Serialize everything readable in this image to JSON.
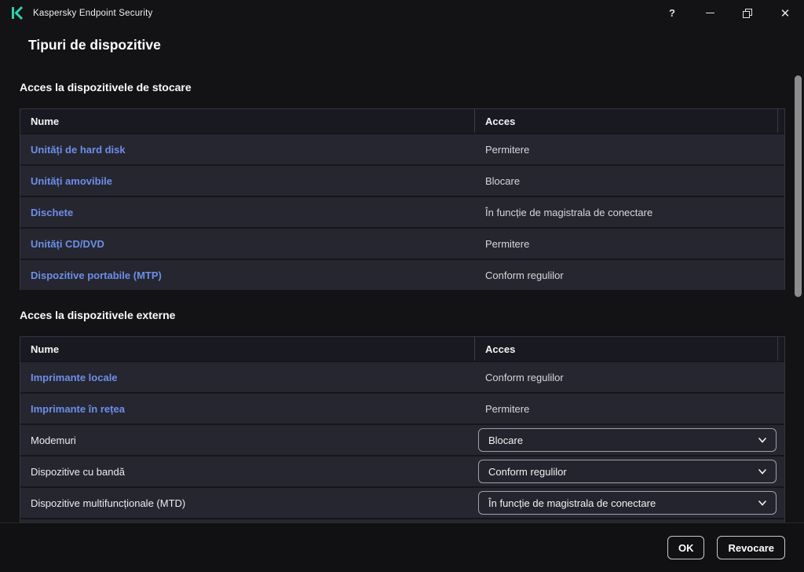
{
  "titlebar": {
    "app_title": "Kaspersky Endpoint Security",
    "help_glyph": "?",
    "close_glyph": "✕"
  },
  "icons": {
    "kaspersky_logo": "teal K mark",
    "minimize": "horizontal bar",
    "restore": "two overlapping squares",
    "close": "x cross",
    "chevron_down": "v chevron"
  },
  "colors": {
    "accent_teal": "#2ed0ae",
    "link_blue": "#6d8ee9",
    "row_bg": "#262630",
    "header_bg": "#191921",
    "page_bg": "#131316"
  },
  "page": {
    "title": "Tipuri de dispozitive"
  },
  "sections": [
    {
      "heading": "Acces la dispozitivele de stocare",
      "columns": {
        "name": "Nume",
        "access": "Acces"
      },
      "rows": [
        {
          "name": "Unități de hard disk",
          "access": "Permitere"
        },
        {
          "name": "Unități amovibile",
          "access": "Blocare"
        },
        {
          "name": "Dischete",
          "access": "În funcție de magistrala de conectare"
        },
        {
          "name": "Unități CD/DVD",
          "access": "Permitere"
        },
        {
          "name": "Dispozitive portabile (MTP)",
          "access": "Conform regulilor"
        }
      ]
    },
    {
      "heading": "Acces la dispozitivele externe",
      "columns": {
        "name": "Nume",
        "access": "Acces"
      },
      "rows": [
        {
          "name": "Imprimante locale",
          "access": "Conform regulilor"
        },
        {
          "name": "Imprimante în rețea",
          "access": "Permitere"
        },
        {
          "name": "Modemuri",
          "access": "Blocare"
        },
        {
          "name": "Dispozitive cu bandă",
          "access": "Conform regulilor"
        },
        {
          "name": "Dispozitive multifuncționale (MTD)",
          "access": "În funcție de magistrala de conectare"
        }
      ]
    }
  ],
  "footer": {
    "ok_label": "OK",
    "cancel_label": "Revocare"
  }
}
